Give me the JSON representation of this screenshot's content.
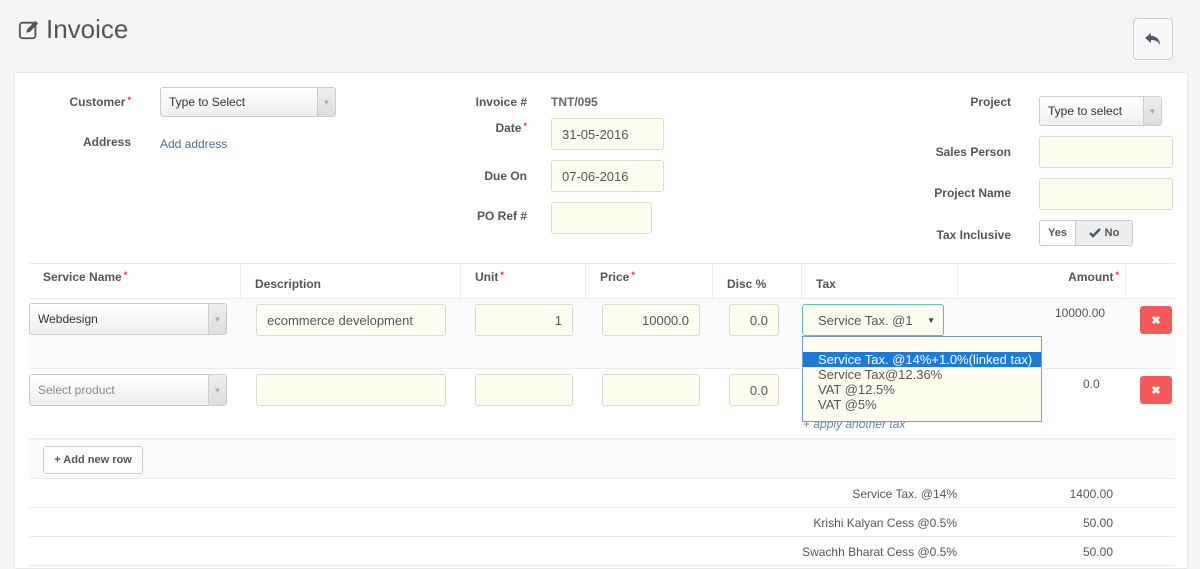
{
  "header": {
    "title": "Invoice",
    "back_icon": "reply-icon"
  },
  "form": {
    "customer": {
      "label": "Customer",
      "required": "*",
      "placeholder": "Type to Select"
    },
    "address": {
      "label": "Address",
      "link": "Add address"
    },
    "invoice_no": {
      "label": "Invoice #",
      "value": "TNT/095"
    },
    "date": {
      "label": "Date",
      "required": "*",
      "value": "31-05-2016"
    },
    "due_on": {
      "label": "Due On",
      "value": "07-06-2016"
    },
    "po_ref": {
      "label": "PO Ref #",
      "value": ""
    },
    "project": {
      "label": "Project",
      "placeholder": "Type to select"
    },
    "sales_person": {
      "label": "Sales Person",
      "value": ""
    },
    "project_name": {
      "label": "Project Name",
      "value": ""
    },
    "tax_inclusive": {
      "label": "Tax Inclusive",
      "yes": "Yes",
      "no": "No",
      "selected": "No"
    }
  },
  "table": {
    "headers": [
      {
        "label": "Service Name",
        "required": "*"
      },
      {
        "label": "Description",
        "required": ""
      },
      {
        "label": "Unit",
        "required": "*"
      },
      {
        "label": "Price",
        "required": "*"
      },
      {
        "label": "Disc %",
        "required": ""
      },
      {
        "label": "Tax",
        "required": ""
      },
      {
        "label": "Amount",
        "required": "*"
      }
    ],
    "rows": [
      {
        "service": "Webdesign",
        "description": "ecommerce development",
        "unit": "1",
        "price": "10000.0",
        "disc": "0.0",
        "tax": "Service Tax. @1",
        "amount": "10000.00"
      },
      {
        "service": "Select product",
        "description": "",
        "unit": "",
        "price": "",
        "disc": "0.0",
        "tax": "",
        "amount": "0.0"
      }
    ],
    "tax_dropdown": {
      "options": [
        "",
        "Service Tax. @14%+1.0%(linked tax)",
        "Service Tax@12.36%",
        "VAT @12.5%",
        "VAT @5%"
      ],
      "highlighted": "Service Tax. @14%+1.0%(linked tax)"
    },
    "apply_another_tax": "+ apply another tax",
    "add_row_label": "+ Add new row"
  },
  "summary": [
    {
      "label": "Service Tax. @14%",
      "value": "1400.00"
    },
    {
      "label": "Krishi Kalyan Cess @0.5%",
      "value": "50.00"
    },
    {
      "label": "Swachh Bharat Cess @0.5%",
      "value": "50.00"
    }
  ],
  "colors": {
    "accent": "#1e7ad6",
    "danger": "#f55a5a",
    "input_bg": "#fdfdf0",
    "focus": "#5fc1aa",
    "link": "#4a6d93"
  }
}
